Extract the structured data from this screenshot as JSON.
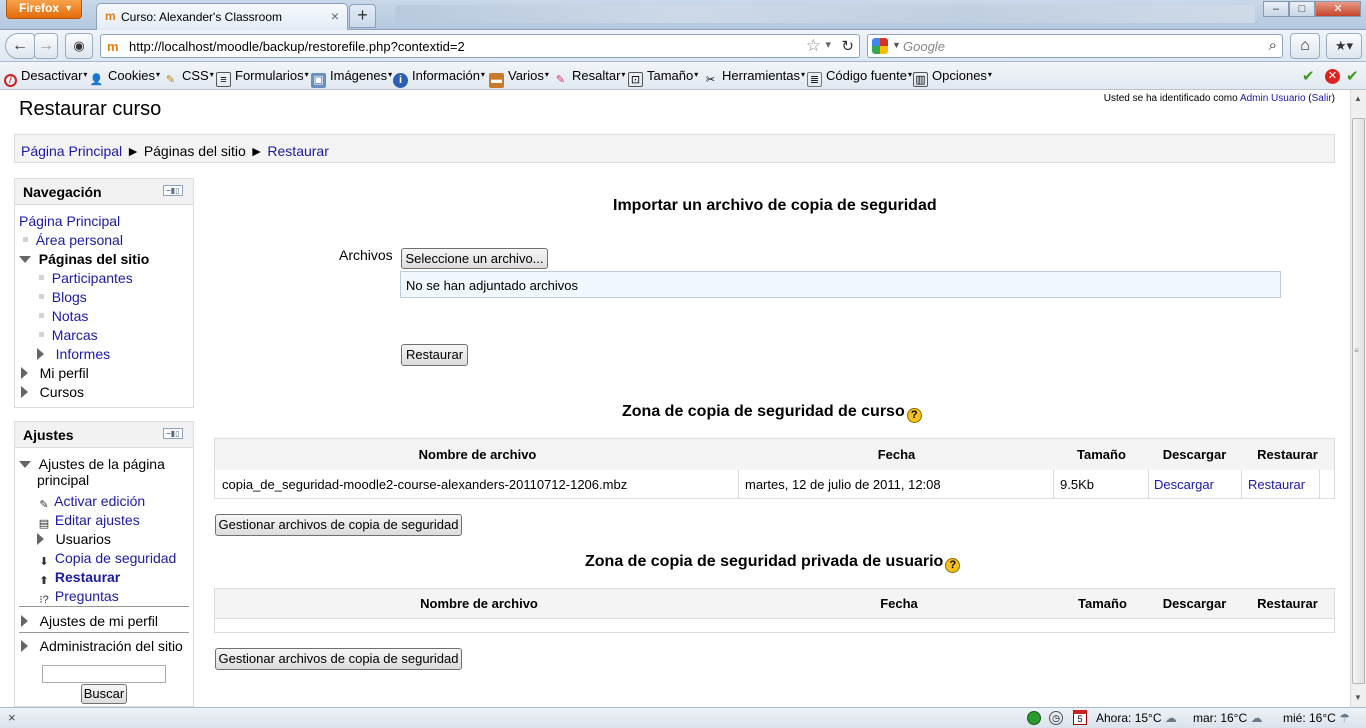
{
  "browser": {
    "app_button": "Firefox",
    "tab_title": "Curso: Alexander's Classroom",
    "url": "http://localhost/moodle/backup/restorefile.php?contextid=2",
    "search_placeholder": "Google"
  },
  "devbar": {
    "items": [
      "Desactivar",
      "Cookies",
      "CSS",
      "Formularios",
      "Imágenes",
      "Información",
      "Varios",
      "Resaltar",
      "Tamaño",
      "Herramientas",
      "Código fuente",
      "Opciones"
    ]
  },
  "page": {
    "title": "Restaurar curso",
    "login_prefix": "Usted se ha identificado como ",
    "login_user": "Admin Usuario",
    "login_logout": "Salir",
    "breadcrumb": [
      "Página Principal",
      "Páginas del sitio",
      "Restaurar"
    ],
    "breadcrumb_sep": "►"
  },
  "navigation": {
    "title": "Navegación",
    "home": "Página Principal",
    "personal_area": "Área personal",
    "site_pages": "Páginas del sitio",
    "site_items": [
      "Participantes",
      "Blogs",
      "Notas",
      "Marcas",
      "Informes"
    ],
    "my_profile": "Mi perfil",
    "courses": "Cursos"
  },
  "settings": {
    "title": "Ajustes",
    "home_settings_line1": "Ajustes de la página",
    "home_settings_line2": "principal",
    "items": [
      "Activar edición",
      "Editar ajustes",
      "Usuarios",
      "Copia de seguridad",
      "Restaurar",
      "Preguntas"
    ],
    "my_profile_settings": "Ajustes de mi perfil",
    "site_admin": "Administración del sitio",
    "search_button": "Buscar"
  },
  "import": {
    "heading": "Importar un archivo de copia de seguridad",
    "files_label": "Archivos",
    "select_button": "Seleccione un archivo...",
    "no_files": "No se han adjuntado archivos",
    "restore_button": "Restaurar"
  },
  "course_zone": {
    "heading": "Zona de copia de seguridad de curso",
    "columns": [
      "Nombre de archivo",
      "Fecha",
      "Tamaño",
      "Descargar",
      "Restaurar"
    ],
    "rows": [
      {
        "filename": "copia_de_seguridad-moodle2-course-alexanders-20110712-1206.mbz",
        "date": "martes, 12 de julio de 2011, 12:08",
        "size": "9.5Kb",
        "download": "Descargar",
        "restore": "Restaurar"
      }
    ],
    "manage_button": "Gestionar archivos de copia de seguridad"
  },
  "user_zone": {
    "heading": "Zona de copia de seguridad privada de usuario",
    "columns": [
      "Nombre de archivo",
      "Fecha",
      "Tamaño",
      "Descargar",
      "Restaurar"
    ],
    "manage_button": "Gestionar archivos de copia de seguridad"
  },
  "statusbar": {
    "weather_now": "Ahora: 15°C",
    "weather_tue": "mar: 16°C",
    "weather_wed": "mié: 16°C",
    "calendar_day": "5"
  }
}
